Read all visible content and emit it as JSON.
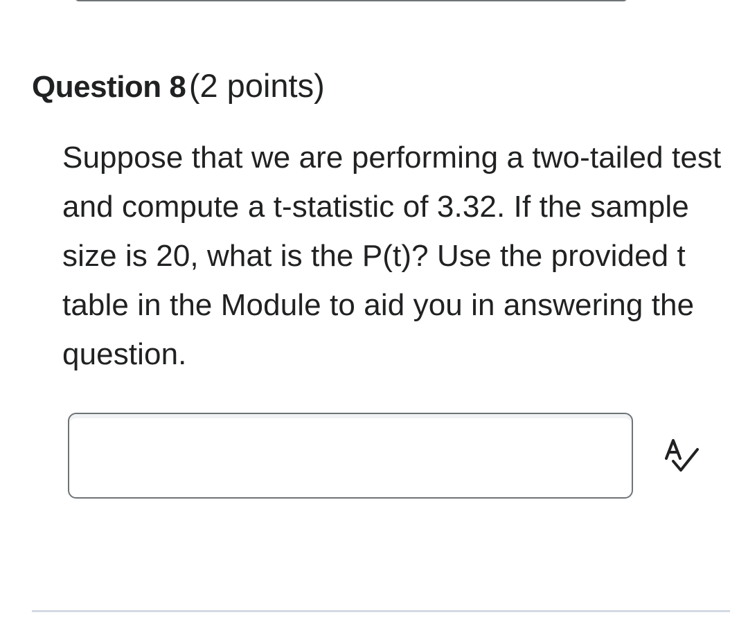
{
  "question": {
    "title": "Question 8",
    "points": "(2 points)",
    "text": "Suppose that we are performing a two-tailed test and compute a t-statistic of 3.32. If the sample size is 20, what is the P(t)? Use the provided t table in the Module to aid you in answering the question."
  },
  "answer": {
    "value": "",
    "placeholder": ""
  },
  "spellcheck": {
    "icon": "spellcheck-icon",
    "color": "#202122"
  },
  "colors": {
    "text": "#202122",
    "border": "#6e7376",
    "divider": "#d3d9e3"
  }
}
